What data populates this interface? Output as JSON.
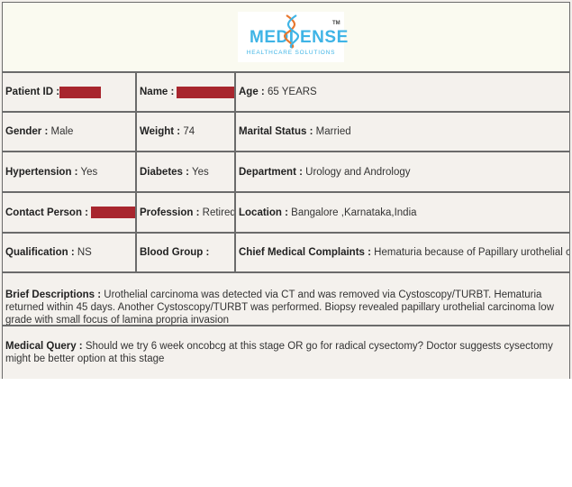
{
  "logo": {
    "brand_left": "MEDI",
    "brand_right": "ENSE",
    "tagline": "HEALTHCARE SOLUTIONS",
    "trademark": "TM",
    "primary_color": "#3fb4e6",
    "accent_color": "#e8772e"
  },
  "row1": {
    "patient_id_label": "Patient ID :",
    "name_label": "Name :",
    "age_label": "Age :",
    "age_value": " 65 YEARS"
  },
  "row2": {
    "gender_label": "Gender :",
    "gender_value": " Male",
    "weight_label": "Weight :",
    "weight_value": " 74",
    "marital_label": "Marital Status :",
    "marital_value": " Married"
  },
  "row3": {
    "hypertension_label": "Hypertension :",
    "hypertension_value": " Yes",
    "diabetes_label": "Diabetes :",
    "diabetes_value": " Yes",
    "department_label": "Department :",
    "department_value": " Urology and Andrology"
  },
  "row4": {
    "contact_label": "Contact Person :",
    "profession_label": "Profession :",
    "profession_value": " Retired",
    "location_label": "Location :",
    "location_value": " Bangalore ,Karnataka,India"
  },
  "row5": {
    "qualification_label": "Qualification :",
    "qualification_value": " NS",
    "blood_group_label": "Blood Group :",
    "blood_group_value": "",
    "complaints_label": "Chief Medical Complaints :",
    "complaints_value": " Hematuria because of Papillary urothelial carcinoma"
  },
  "brief": {
    "label": "Brief Descriptions :",
    "value": " Urothelial carcinoma was detected via CT and was removed via Cystoscopy/TURBT. Hematuria returned within 45 days. Another Cystoscopy/TURBT was performed. Biopsy revealed papillary urothelial carcinoma low grade with small focus of lamina propria invasion"
  },
  "query": {
    "label": "Medical Query :",
    "value": " Should we try 6 week oncobcg at this stage OR go for radical cysectomy? Doctor suggests cysectomy might be better option at this stage"
  },
  "redaction_color": "#a8262e"
}
